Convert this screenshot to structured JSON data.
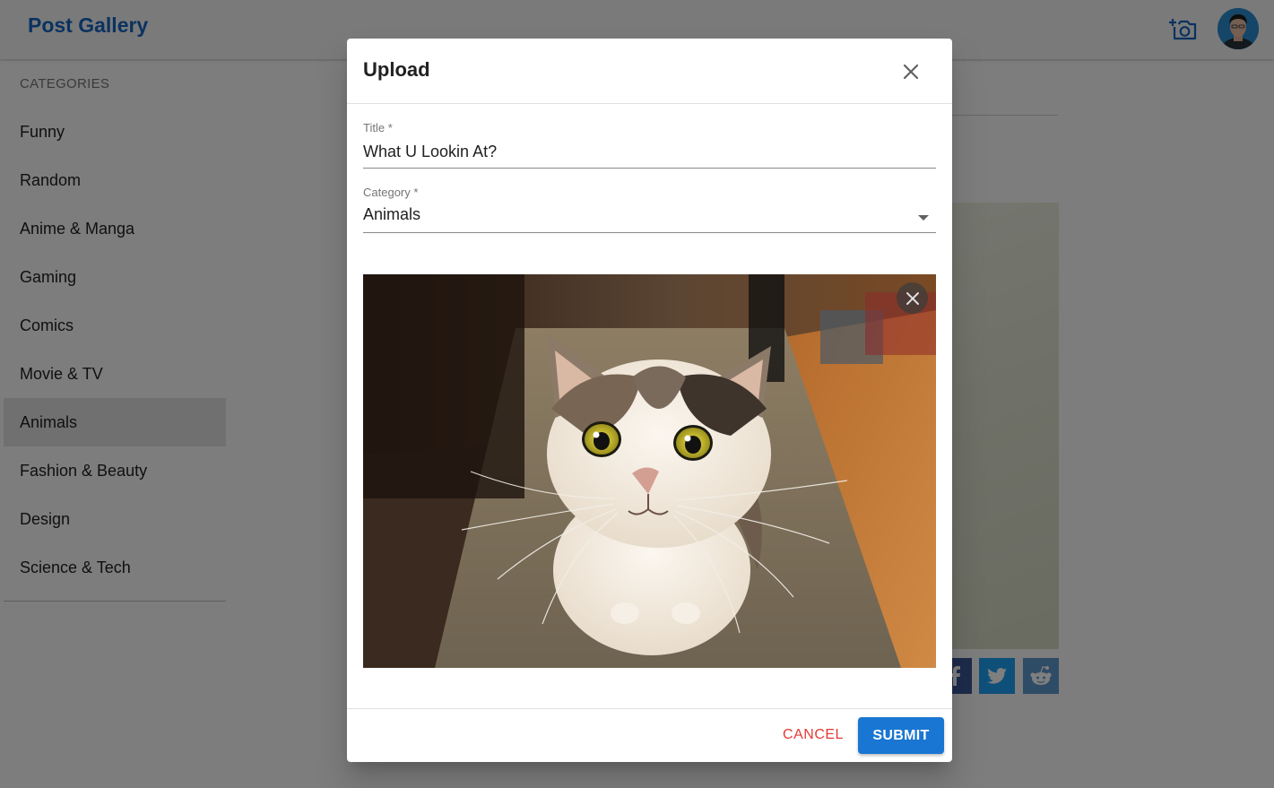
{
  "app": {
    "brand": "Post Gallery"
  },
  "sidebar": {
    "header": "CATEGORIES",
    "items": [
      {
        "label": "Funny"
      },
      {
        "label": "Random"
      },
      {
        "label": "Anime & Manga"
      },
      {
        "label": "Gaming"
      },
      {
        "label": "Comics"
      },
      {
        "label": "Movie & TV"
      },
      {
        "label": "Animals",
        "active": true
      },
      {
        "label": "Fashion & Beauty"
      },
      {
        "label": "Design"
      },
      {
        "label": "Science & Tech"
      }
    ]
  },
  "dialog": {
    "title": "Upload",
    "title_field": {
      "label": "Title *",
      "value": "What U Lookin At?"
    },
    "category_field": {
      "label": "Category *",
      "value": "Animals"
    },
    "preview": {
      "alt": "Wide-eyed tabby and white cat looking at the camera"
    },
    "cancel_label": "CANCEL",
    "submit_label": "SUBMIT"
  },
  "colors": {
    "brand": "#1565c0",
    "primary": "#1976d2",
    "cancel": "#e53935",
    "facebook": "#3b5998",
    "twitter": "#1da1f2",
    "reddit": "#5f99cf"
  },
  "icons": {
    "upload_action": "add-a-photo-icon",
    "dialog_close": "close-icon",
    "preview_remove": "close-icon",
    "share": [
      "facebook-icon",
      "twitter-icon",
      "reddit-icon"
    ]
  }
}
